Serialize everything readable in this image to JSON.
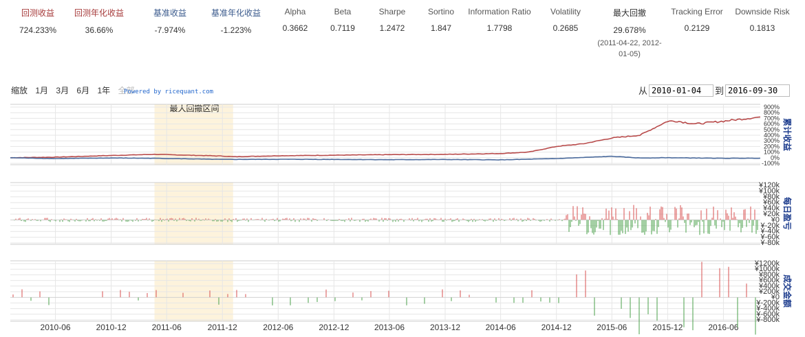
{
  "metrics": [
    {
      "label": "回测收益",
      "value": "724.233%",
      "color": "#a63a3a"
    },
    {
      "label": "回测年化收益",
      "value": "36.66%",
      "color": "#a63a3a"
    },
    {
      "label": "基准收益",
      "value": "-7.974%",
      "color": "#3a5a8c"
    },
    {
      "label": "基准年化收益",
      "value": "-1.223%",
      "color": "#3a5a8c"
    },
    {
      "label": "Alpha",
      "value": "0.3662",
      "color": "#555555"
    },
    {
      "label": "Beta",
      "value": "0.7119",
      "color": "#555555"
    },
    {
      "label": "Sharpe",
      "value": "1.2472",
      "color": "#555555"
    },
    {
      "label": "Sortino",
      "value": "1.847",
      "color": "#555555"
    },
    {
      "label": "Information Ratio",
      "value": "1.7798",
      "color": "#555555"
    },
    {
      "label": "Volatility",
      "value": "0.2685",
      "color": "#555555"
    },
    {
      "label": "最大回撤",
      "value": "29.678%",
      "color": "#333333",
      "sub": "(2011-04-22, 2012-01-05)"
    },
    {
      "label": "Tracking Error",
      "value": "0.2129",
      "color": "#555555"
    },
    {
      "label": "Downside Risk",
      "value": "0.1813",
      "color": "#555555"
    }
  ],
  "toolbar": {
    "zoom_label": "缩放",
    "zoom_options": [
      "1月",
      "3月",
      "6月",
      "1年",
      "全部"
    ],
    "powered": "Powered by ricequant.com",
    "from_label": "从",
    "to_label": "到",
    "from_date": "2010-01-04",
    "to_date": "2016-09-30"
  },
  "chart_data": [
    {
      "type": "line",
      "ylabel": "累计收益",
      "annotation": "最大回撤区间",
      "highlight_range": [
        "2011-04-22",
        "2012-01-05"
      ],
      "y_ticks": [
        "900%",
        "800%",
        "700%",
        "600%",
        "500%",
        "400%",
        "300%",
        "200%",
        "100%",
        "0%",
        "-100%"
      ],
      "ylim": [
        -100,
        900
      ],
      "series": [
        {
          "color": "#b84a4a",
          "x": [
            "2010-01-04",
            "2010-06",
            "2010-12",
            "2011-04-22",
            "2011-12",
            "2012-01-05",
            "2012-06",
            "2012-12",
            "2013-06",
            "2013-12",
            "2014-06",
            "2014-09",
            "2014-12",
            "2015-03",
            "2015-06",
            "2015-09",
            "2015-12",
            "2016-01",
            "2016-03",
            "2016-06",
            "2016-09-30"
          ],
          "values": [
            0,
            10,
            40,
            60,
            30,
            18,
            35,
            45,
            55,
            60,
            75,
            100,
            200,
            250,
            350,
            400,
            650,
            650,
            600,
            650,
            724
          ]
        },
        {
          "color": "#4a6a9c",
          "x": [
            "2010-01-04",
            "2010-06",
            "2010-12",
            "2011-04-22",
            "2011-12",
            "2012-06",
            "2012-12",
            "2013-06",
            "2013-12",
            "2014-06",
            "2014-12",
            "2015-06",
            "2015-09",
            "2015-12",
            "2016-06",
            "2016-09-30"
          ],
          "values": [
            0,
            -15,
            -5,
            -10,
            -30,
            -28,
            -30,
            -35,
            -32,
            -38,
            -15,
            25,
            -5,
            0,
            -10,
            -8
          ]
        }
      ]
    },
    {
      "type": "bar",
      "ylabel": "每日盈亏",
      "y_ticks": [
        "¥120k",
        "¥100k",
        "¥80k",
        "¥60k",
        "¥40k",
        "¥20k",
        "¥0",
        "¥-20k",
        "¥-40k",
        "¥-60k",
        "¥-80k"
      ],
      "ylim": [
        -80000,
        120000
      ],
      "colors": {
        "positive": "#d85050",
        "negative": "#4aa04a"
      }
    },
    {
      "type": "bar",
      "ylabel": "成交金额",
      "y_ticks": [
        "¥1200k",
        "¥1000k",
        "¥800k",
        "¥600k",
        "¥400k",
        "¥200k",
        "¥0",
        "¥-200k",
        "¥-400k",
        "¥-600k",
        "¥-800k"
      ],
      "ylim": [
        -800000,
        1200000
      ],
      "colors": {
        "positive": "#d85050",
        "negative": "#4aa04a"
      }
    }
  ],
  "x_axis": {
    "start": "2010-01-04",
    "end": "2016-09-30",
    "ticks": [
      "2010-06",
      "2010-12",
      "2011-06",
      "2011-12",
      "2012-06",
      "2012-12",
      "2013-06",
      "2013-12",
      "2014-06",
      "2014-12",
      "2015-06",
      "2015-12",
      "2016-06"
    ]
  }
}
